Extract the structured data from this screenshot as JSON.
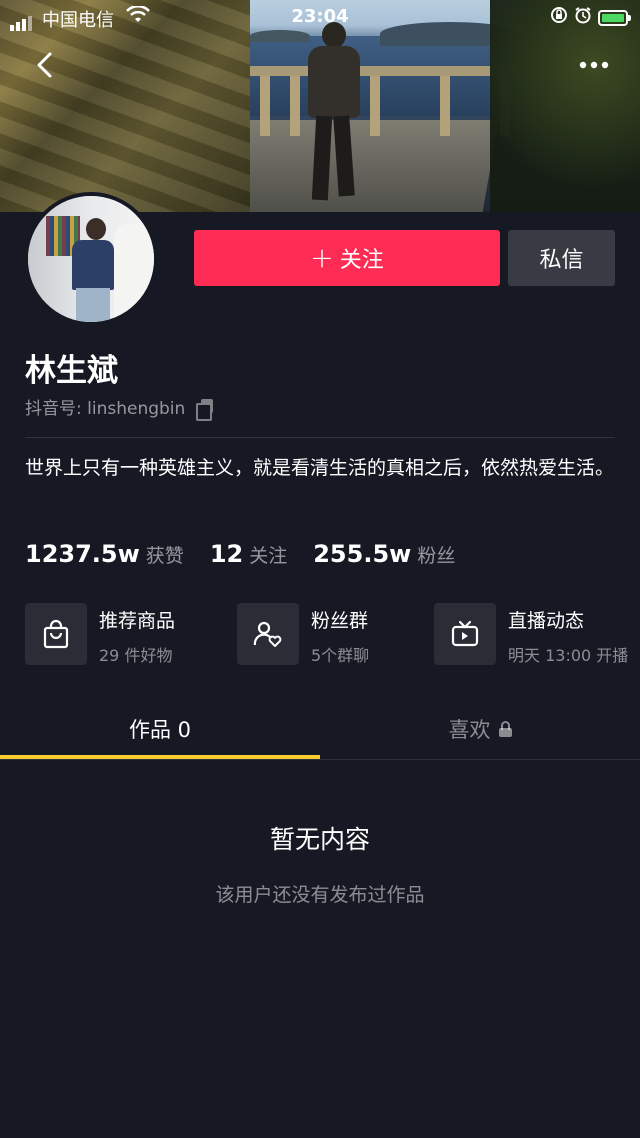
{
  "status_bar": {
    "carrier": "中国电信",
    "time": "23:04"
  },
  "header": {
    "back_icon": "chevron-left-icon",
    "more_icon": "more-icon"
  },
  "profile": {
    "follow_label": "关注",
    "message_label": "私信",
    "name": "林生斌",
    "id_prefix": "抖音号: ",
    "id_value": "linshengbin",
    "bio": "世界上只有一种英雄主义，就是看清生活的真相之后，依然热爱生活。"
  },
  "stats": [
    {
      "value": "1237.5w",
      "label": "获赞"
    },
    {
      "value": "12",
      "label": "关注"
    },
    {
      "value": "255.5w",
      "label": "粉丝"
    }
  ],
  "features": [
    {
      "title": "推荐商品",
      "subtitle": "29 件好物",
      "icon": "shopping-bag-icon"
    },
    {
      "title": "粉丝群",
      "subtitle": "5个群聊",
      "icon": "fan-group-icon"
    },
    {
      "title": "直播动态",
      "subtitle": "明天 13:00 开播",
      "icon": "live-tv-icon"
    }
  ],
  "tabs": [
    {
      "label": "作品 0",
      "active": true
    },
    {
      "label": "喜欢",
      "active": false,
      "locked": true
    }
  ],
  "empty_state": {
    "title": "暂无内容",
    "subtitle": "该用户还没有发布过作品"
  },
  "colors": {
    "background": "#161823",
    "follow_button": "#fe2c55",
    "tab_indicator": "#facd2c"
  }
}
